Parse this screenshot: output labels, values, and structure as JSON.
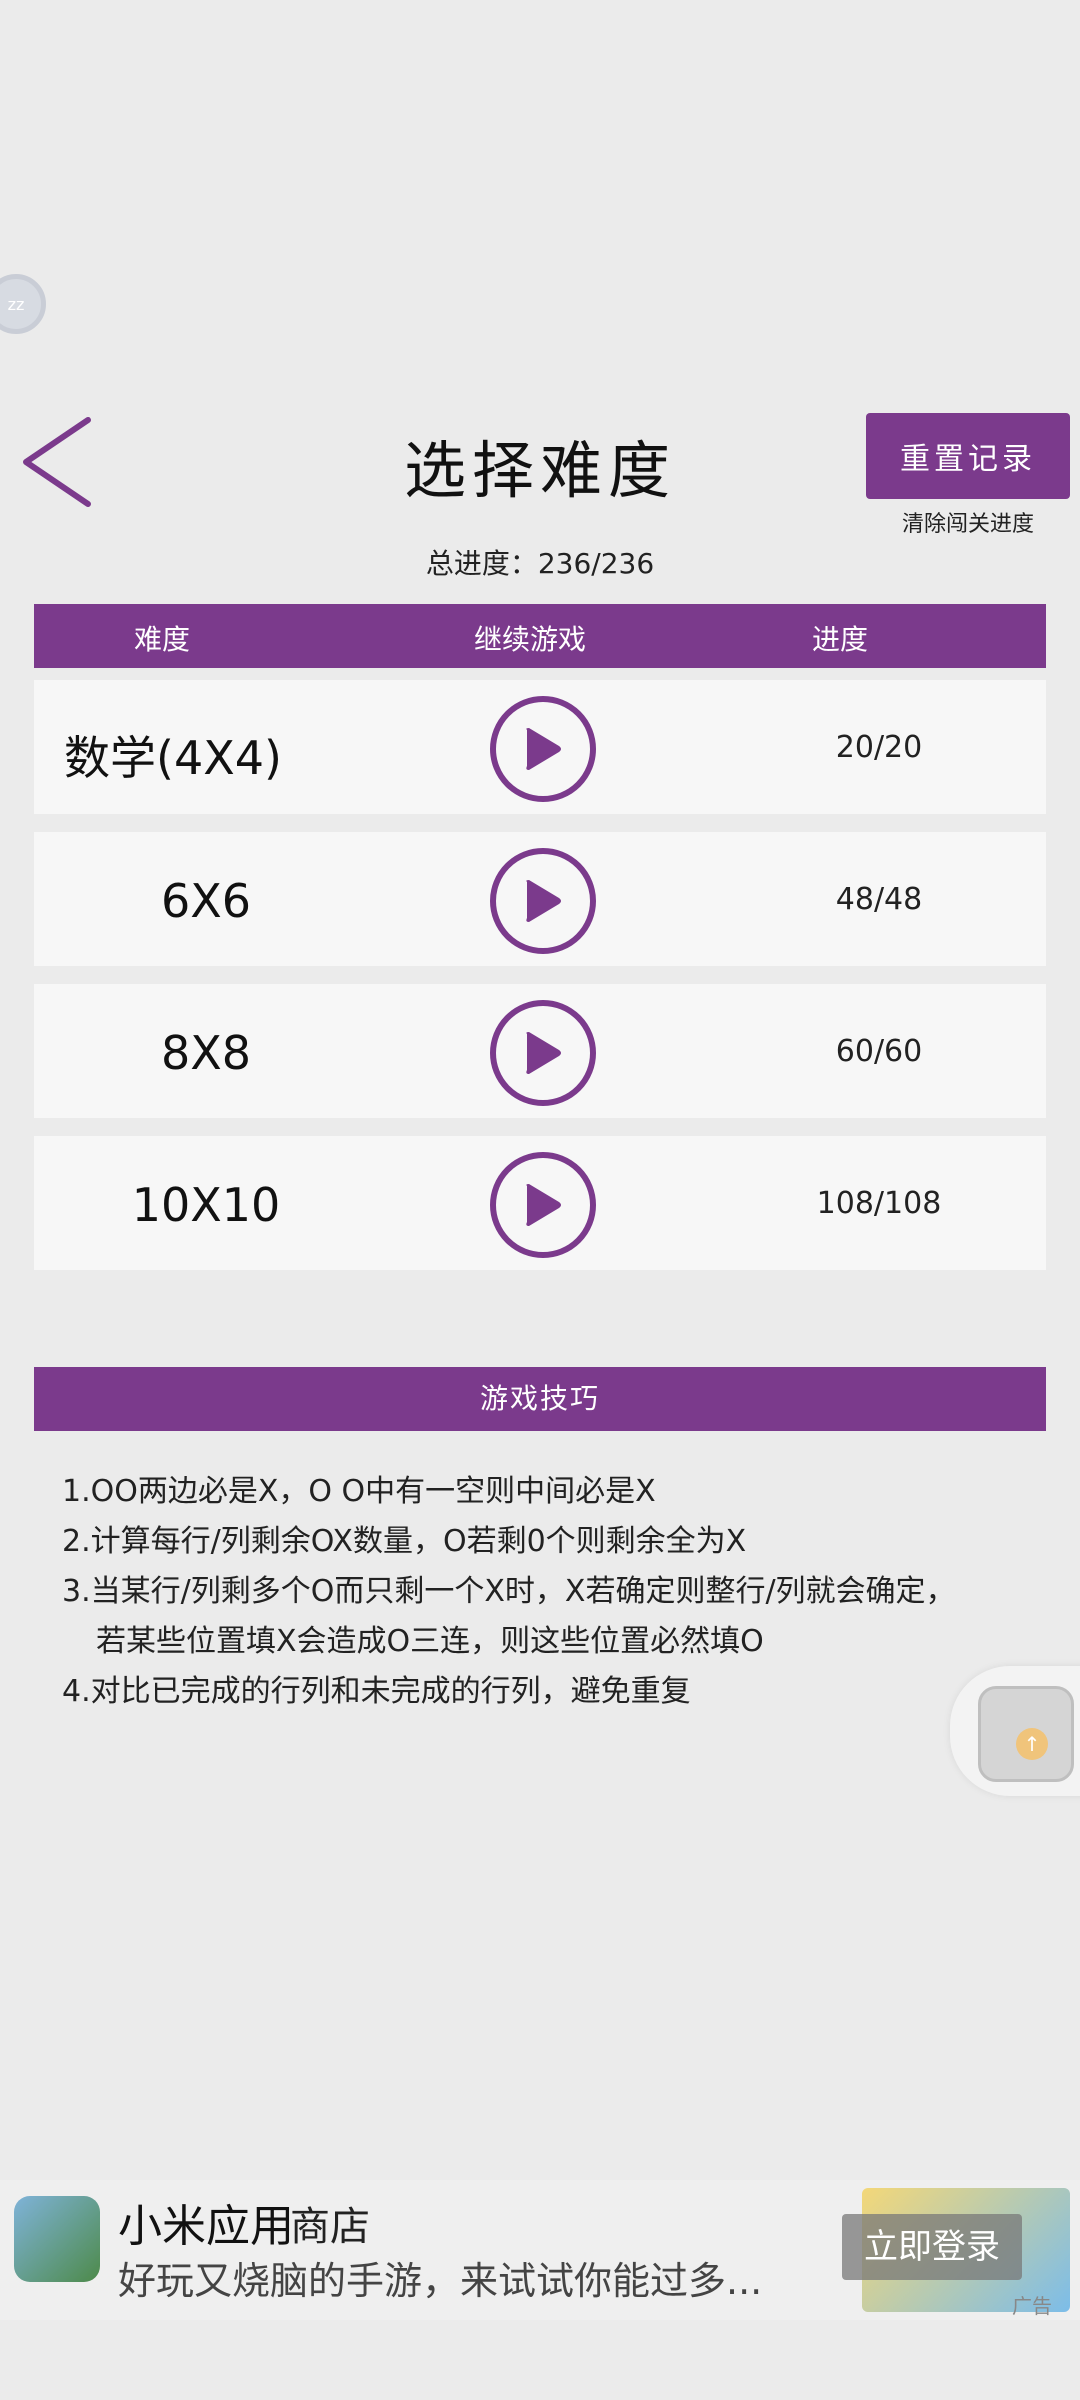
{
  "header": {
    "title": "选择难度",
    "reset_label": "重置记录",
    "reset_sub": "清除闯关进度",
    "total_progress": "总进度：236/236"
  },
  "table": {
    "columns": [
      "难度",
      "继续游戏",
      "进度"
    ],
    "rows": [
      {
        "name": "数学(4X4)",
        "progress": "20/20"
      },
      {
        "name": "6X6",
        "progress": "48/48"
      },
      {
        "name": "8X8",
        "progress": "60/60"
      },
      {
        "name": "10X10",
        "progress": "108/108"
      }
    ]
  },
  "tips": {
    "title": "游戏技巧",
    "items": [
      "1.OO两边必是X，O O中有一空则中间必是X",
      "2.计算每行/列剩余OX数量，O若剩0个则剩余全为X",
      "3.当某行/列剩多个O而只剩一个X时，X若确定则整行/列就会确定，",
      "若某些位置填X会造成O三连，则这些位置必然填O",
      "4.对比已完成的行列和未完成的行列，避免重复"
    ]
  },
  "floating": {
    "left_badge": "zz"
  },
  "ad": {
    "app_name": "小米应用",
    "store_text": "商店",
    "desc": "好玩又烧脑的手游，来试试你能过多...",
    "login_label": "立即登录",
    "ad_tag": "广告"
  },
  "colors": {
    "accent": "#7b3a8c",
    "background": "#ebebeb"
  }
}
